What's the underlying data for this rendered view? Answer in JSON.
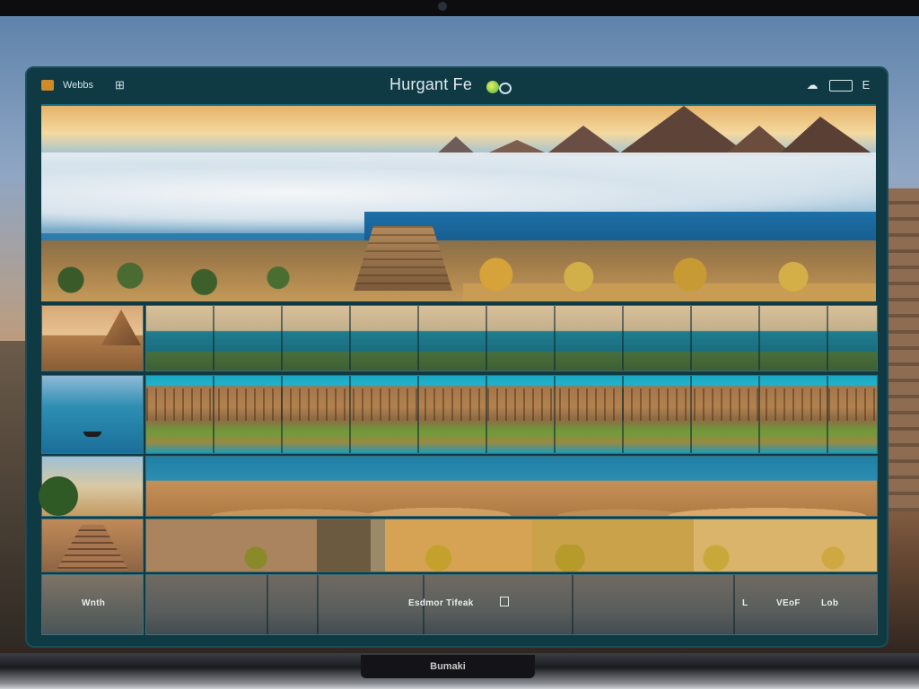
{
  "window": {
    "app_name": "Webbs",
    "grid_glyph": "⊞",
    "title": "Hurgant F",
    "title_suffix": "e",
    "controls": {
      "cloud": "☁",
      "close": "E"
    }
  },
  "gallery": {
    "captions": {
      "left": "Wnth",
      "middle": "Esdmor Tifeak",
      "right_a": "L",
      "right_b": "VEoF",
      "right_c": "Lob"
    }
  },
  "laptop": {
    "brand": "Bumaki"
  },
  "icons": [
    "app-icon",
    "grid-icon",
    "cloud-icon",
    "maximize-icon",
    "close-icon",
    "badge-icon"
  ]
}
